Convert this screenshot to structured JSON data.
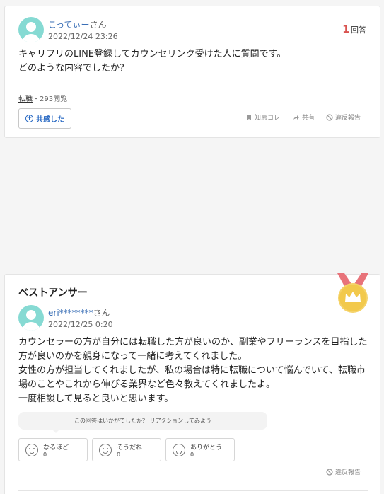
{
  "question": {
    "user_name": "こってぃーさん",
    "user_name_main": "こってぃー",
    "user_suffix": "さん",
    "date": "2022/12/24 23:26",
    "answer_count": "1",
    "answer_label": "回答",
    "text_line1": "キャリフリのLINE登録してカウンセリンク受けた人に質問です。",
    "text_line2": "どのような内容でしたか？",
    "category": "転職",
    "views": "・293閲覧",
    "empathy_label": "共感した",
    "actions": {
      "chiebukuro": "知恵コレ",
      "share": "共有",
      "report": "違反報告"
    }
  },
  "best_answer": {
    "title": "ベストアンサー",
    "user_name_main": "eri********",
    "user_suffix": "さん",
    "date": "2022/12/25 0:20",
    "text_line1": "カウンセラーの方が自分には転職した方が良いのか、副業やフリーランスを目指した",
    "text_line2": "方が良いのかを親身になって一緒に考えてくれました。",
    "text_line3": "女性の方が担当してくれましたが、私の場合は特に転職について悩んでいて、転職市",
    "text_line4": "場のことやこれから伸びる業界など色々教えてくれましたよ。",
    "text_line5": "一度相談して見ると良いと思います。",
    "reaction_prompt": "この回答はいかがでしたか？ リアクションしてみよう",
    "reactions": [
      {
        "label": "なるほど",
        "count": "0"
      },
      {
        "label": "そうだね",
        "count": "0"
      },
      {
        "label": "ありがとう",
        "count": "0"
      }
    ],
    "report": "違反報告"
  },
  "colors": {
    "accent_blue": "#2b6bc4",
    "avatar_teal": "#86dad3",
    "count_red": "#d9534f",
    "medal_gold": "#f2c94c",
    "ribbon_red": "#e8737a"
  }
}
